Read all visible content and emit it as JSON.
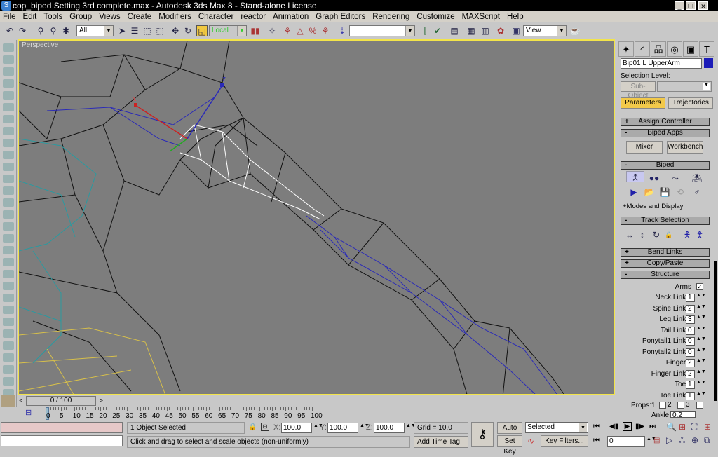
{
  "window": {
    "title": "cop_biped Setting 3rd complete.max - Autodesk 3ds Max 8  - Stand-alone License",
    "buttons": [
      "_",
      "❐",
      "✕"
    ]
  },
  "menu": [
    "File",
    "Edit",
    "Tools",
    "Group",
    "Views",
    "Create",
    "Modifiers",
    "Character",
    "reactor",
    "Animation",
    "Graph Editors",
    "Rendering",
    "Customize",
    "MAXScript",
    "Help"
  ],
  "toolbar": {
    "selection_filter": "All",
    "ref_coord": "Local",
    "named_selection": "",
    "view_dropdown": "View"
  },
  "viewport": {
    "label": "Perspective",
    "axis": {
      "x": "X",
      "z": "Z"
    }
  },
  "command_panel": {
    "object_name": "Bip01 L UpperArm",
    "object_color": "#1c1cb8",
    "selection_level_label": "Selection Level:",
    "sub_object": "Sub-Object",
    "tabs": {
      "parameters": "Parameters",
      "trajectories": "Trajectories"
    },
    "rollouts": {
      "assign_controller": "Assign Controller",
      "biped_apps": "Biped Apps",
      "biped": "Biped",
      "track_selection": "Track Selection",
      "bend_links": "Bend Links",
      "copy_paste": "Copy/Paste",
      "structure": "Structure"
    },
    "mixer": "Mixer",
    "workbench": "Workbench",
    "modes_display": "+Modes and Display",
    "structure": {
      "arms_label": "Arms",
      "arms": true,
      "fields": [
        {
          "label": "Neck Links:",
          "value": "1"
        },
        {
          "label": "Spine Links:",
          "value": "2"
        },
        {
          "label": "Leg Links:",
          "value": "3"
        },
        {
          "label": "Tail Links:",
          "value": "0"
        },
        {
          "label": "Ponytail1 Links:",
          "value": "0"
        },
        {
          "label": "Ponytail2 Links:",
          "value": "0"
        },
        {
          "label": "Fingers:",
          "value": "2"
        },
        {
          "label": "Finger Links:",
          "value": "2"
        },
        {
          "label": "Toes:",
          "value": "1"
        },
        {
          "label": "Toe Links:",
          "value": "1"
        }
      ],
      "props_label": "Props:",
      "props": [
        "1",
        "2",
        "3"
      ],
      "ankle_label": "Ankle Attach:",
      "ankle_value": "0.2"
    }
  },
  "timeline": {
    "slider": "0 / 100",
    "ticks": [
      "0",
      "5",
      "10",
      "15",
      "20",
      "25",
      "30",
      "35",
      "40",
      "45",
      "50",
      "55",
      "60",
      "65",
      "70",
      "75",
      "80",
      "85",
      "90",
      "95",
      "100"
    ]
  },
  "status": {
    "selection": "1 Object Selected",
    "prompt": "Click and drag to select and scale objects (non-uniformly)",
    "x_label": "X:",
    "x": "100.0",
    "y_label": "Y:",
    "y": "100.0",
    "z_label": "Z:",
    "z": "100.0",
    "grid": "Grid = 10.0",
    "add_time_tag": "Add Time Tag",
    "auto_key": "Auto Key",
    "set_key": "Set Key",
    "key_mode": "Selected",
    "key_filters": "Key Filters...",
    "frame": "0"
  }
}
